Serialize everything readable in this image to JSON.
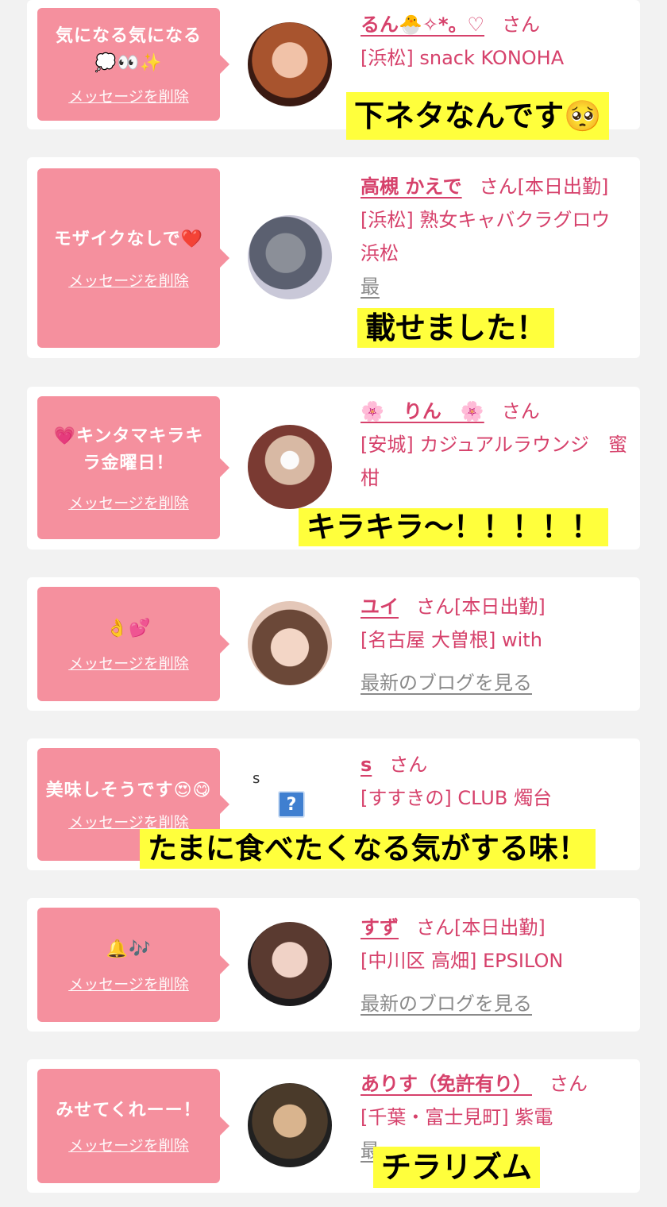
{
  "colors": {
    "bubble": "#f5909e",
    "name": "#d6416b",
    "caption_bg": "#ffff3c",
    "blog": "#8a8a8a"
  },
  "entries": [
    {
      "message": "気になる気になる💭👀✨",
      "delete_label": "メッセージを削除",
      "name": "るん🐣✧*。♡",
      "san": "さん",
      "shop": "[浜松] snack KONOHA",
      "caption": "下ネタなんです🥺"
    },
    {
      "message": "モザイクなしで❤️",
      "delete_label": "メッセージを削除",
      "name": "高槻 かえで",
      "san": "さん[本日出勤]",
      "shop": "[浜松] 熟女キャバクラグロウ 浜松",
      "blog": "最",
      "caption": "載せました！"
    },
    {
      "message": "💗キンタマキラキラ金曜日！",
      "delete_label": "メッセージを削除",
      "name": "🌸　りん　🌸",
      "san": "さん",
      "shop": "[安城] カジュアルラウンジ　蜜柑",
      "caption": "キラキラ〜！！！！！"
    },
    {
      "message": "👌💕",
      "delete_label": "メッセージを削除",
      "name": "ユイ",
      "san": "さん[本日出勤]",
      "shop": "[名古屋 大曽根] with",
      "blog": "最新のブログを見る"
    },
    {
      "message": "美味しそうです😍😋",
      "delete_label": "メッセージを削除",
      "name": "s",
      "san": "さん",
      "shop": "[すすきの] CLUB 燭台",
      "avatar_alt": "s",
      "avatar_icon": "?",
      "caption": "たまに食べたくなる気がする味！"
    },
    {
      "message": "🔔🎶",
      "delete_label": "メッセージを削除",
      "name": "すず",
      "san": "さん[本日出勤]",
      "shop": "[中川区 高畑] EPSILON",
      "blog": "最新のブログを見る"
    },
    {
      "message": "みせてくれーー！",
      "delete_label": "メッセージを削除",
      "name": "ありす（免許有り）",
      "san": "さん",
      "shop": "[千葉・富士見町] 紫電",
      "blog": "最",
      "caption": "チラリズム"
    }
  ]
}
